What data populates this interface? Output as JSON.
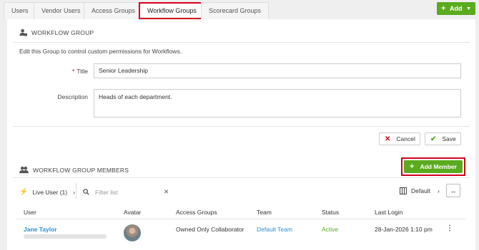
{
  "tabs": [
    {
      "label": "Users"
    },
    {
      "label": "Vendor Users"
    },
    {
      "label": "Access Groups"
    },
    {
      "label": "Workflow Groups"
    },
    {
      "label": "Scorecard Groups"
    }
  ],
  "add_button": {
    "label": "Add",
    "icon": "plus-icon"
  },
  "workflow_group": {
    "title": "WORKFLOW GROUP",
    "description_text": "Edit this Group to control custom permissions for Workflows.",
    "title_label": "Title",
    "title_value": "Senior Leadership",
    "description_label": "Description",
    "description_value": "Heads of each department."
  },
  "actions": {
    "cancel": "Cancel",
    "save": "Save"
  },
  "members": {
    "title": "WORKFLOW GROUP MEMBERS",
    "add_member": "Add Member",
    "live_user": "Live User (1)",
    "filter_placeholder": "Filter list",
    "view_label": "Default",
    "columns": [
      "User",
      "Avatar",
      "Access Groups",
      "Team",
      "Status",
      "Last Login"
    ],
    "rows": [
      {
        "user": "Jane Taylor",
        "access_groups": "Owned Only Collaborator",
        "team": "Default Team",
        "status": "Active",
        "last_login": "28-Jan-2026 1:10 pm"
      }
    ]
  },
  "colors": {
    "accent_green": "#5aab1e",
    "highlight_red": "#d0021b",
    "link_blue": "#2a8fd6"
  }
}
